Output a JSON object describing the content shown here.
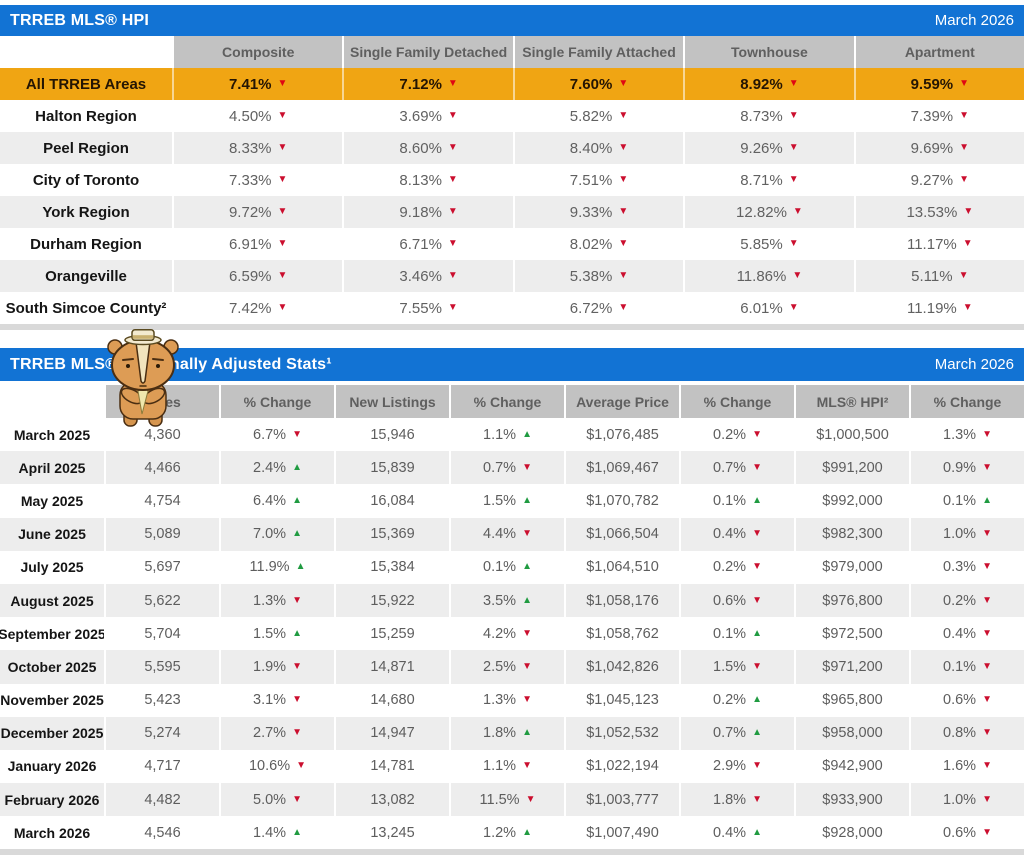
{
  "colors": {
    "header_blue": "#1273d4",
    "highlight_orange": "#f0a513",
    "column_header_gray": "#c2c2c2",
    "alt_row_gray": "#ededed",
    "down_arrow_red": "#cb0e2e",
    "up_arrow_green": "#209b41"
  },
  "hpi_table": {
    "title": "TRREB MLS® HPI",
    "date": "March 2026",
    "columns": [
      "Composite",
      "Single Family Detached",
      "Single Family Attached",
      "Townhouse",
      "Apartment"
    ],
    "highlight_row": {
      "label": "All TRREB Areas",
      "values": [
        {
          "v": "7.41%",
          "d": "down"
        },
        {
          "v": "7.12%",
          "d": "down"
        },
        {
          "v": "7.60%",
          "d": "down"
        },
        {
          "v": "8.92%",
          "d": "down"
        },
        {
          "v": "9.59%",
          "d": "down"
        }
      ]
    },
    "rows": [
      {
        "label": "Halton Region",
        "values": [
          {
            "v": "4.50%",
            "d": "down"
          },
          {
            "v": "3.69%",
            "d": "down"
          },
          {
            "v": "5.82%",
            "d": "down"
          },
          {
            "v": "8.73%",
            "d": "down"
          },
          {
            "v": "7.39%",
            "d": "down"
          }
        ]
      },
      {
        "label": "Peel Region",
        "values": [
          {
            "v": "8.33%",
            "d": "down"
          },
          {
            "v": "8.60%",
            "d": "down"
          },
          {
            "v": "8.40%",
            "d": "down"
          },
          {
            "v": "9.26%",
            "d": "down"
          },
          {
            "v": "9.69%",
            "d": "down"
          }
        ]
      },
      {
        "label": "City of Toronto",
        "values": [
          {
            "v": "7.33%",
            "d": "down"
          },
          {
            "v": "8.13%",
            "d": "down"
          },
          {
            "v": "7.51%",
            "d": "down"
          },
          {
            "v": "8.71%",
            "d": "down"
          },
          {
            "v": "9.27%",
            "d": "down"
          }
        ]
      },
      {
        "label": "York Region",
        "values": [
          {
            "v": "9.72%",
            "d": "down"
          },
          {
            "v": "9.18%",
            "d": "down"
          },
          {
            "v": "9.33%",
            "d": "down"
          },
          {
            "v": "12.82%",
            "d": "down"
          },
          {
            "v": "13.53%",
            "d": "down"
          }
        ]
      },
      {
        "label": "Durham Region",
        "values": [
          {
            "v": "6.91%",
            "d": "down"
          },
          {
            "v": "6.71%",
            "d": "down"
          },
          {
            "v": "8.02%",
            "d": "down"
          },
          {
            "v": "5.85%",
            "d": "down"
          },
          {
            "v": "11.17%",
            "d": "down"
          }
        ]
      },
      {
        "label": "Orangeville",
        "values": [
          {
            "v": "6.59%",
            "d": "down"
          },
          {
            "v": "3.46%",
            "d": "down"
          },
          {
            "v": "5.38%",
            "d": "down"
          },
          {
            "v": "11.86%",
            "d": "down"
          },
          {
            "v": "5.11%",
            "d": "down"
          }
        ]
      },
      {
        "label": "South Simcoe County²",
        "values": [
          {
            "v": "7.42%",
            "d": "down"
          },
          {
            "v": "7.55%",
            "d": "down"
          },
          {
            "v": "6.72%",
            "d": "down"
          },
          {
            "v": "6.01%",
            "d": "down"
          },
          {
            "v": "11.19%",
            "d": "down"
          }
        ]
      }
    ]
  },
  "stats_table": {
    "title": "TRREB MLS® Seasonally Adjusted Stats¹",
    "date": "March 2026",
    "columns": [
      "Sales",
      "% Change",
      "New Listings",
      "% Change",
      "Average Price",
      "% Change",
      "MLS® HPI²",
      "% Change"
    ],
    "rows": [
      {
        "month": "March 2025",
        "cells": [
          "4,360",
          {
            "v": "6.7%",
            "d": "down"
          },
          "15,946",
          {
            "v": "1.1%",
            "d": "up"
          },
          "$1,076,485",
          {
            "v": "0.2%",
            "d": "down"
          },
          "$1,000,500",
          {
            "v": "1.3%",
            "d": "down"
          }
        ]
      },
      {
        "month": "April 2025",
        "cells": [
          "4,466",
          {
            "v": "2.4%",
            "d": "up"
          },
          "15,839",
          {
            "v": "0.7%",
            "d": "down"
          },
          "$1,069,467",
          {
            "v": "0.7%",
            "d": "down"
          },
          "$991,200",
          {
            "v": "0.9%",
            "d": "down"
          }
        ]
      },
      {
        "month": "May 2025",
        "cells": [
          "4,754",
          {
            "v": "6.4%",
            "d": "up"
          },
          "16,084",
          {
            "v": "1.5%",
            "d": "up"
          },
          "$1,070,782",
          {
            "v": "0.1%",
            "d": "up"
          },
          "$992,000",
          {
            "v": "0.1%",
            "d": "up"
          }
        ]
      },
      {
        "month": "June 2025",
        "cells": [
          "5,089",
          {
            "v": "7.0%",
            "d": "up"
          },
          "15,369",
          {
            "v": "4.4%",
            "d": "down"
          },
          "$1,066,504",
          {
            "v": "0.4%",
            "d": "down"
          },
          "$982,300",
          {
            "v": "1.0%",
            "d": "down"
          }
        ]
      },
      {
        "month": "July 2025",
        "cells": [
          "5,697",
          {
            "v": "11.9%",
            "d": "up"
          },
          "15,384",
          {
            "v": "0.1%",
            "d": "up"
          },
          "$1,064,510",
          {
            "v": "0.2%",
            "d": "down"
          },
          "$979,000",
          {
            "v": "0.3%",
            "d": "down"
          }
        ]
      },
      {
        "month": "August 2025",
        "cells": [
          "5,622",
          {
            "v": "1.3%",
            "d": "down"
          },
          "15,922",
          {
            "v": "3.5%",
            "d": "up"
          },
          "$1,058,176",
          {
            "v": "0.6%",
            "d": "down"
          },
          "$976,800",
          {
            "v": "0.2%",
            "d": "down"
          }
        ]
      },
      {
        "month": "September 2025",
        "cells": [
          "5,704",
          {
            "v": "1.5%",
            "d": "up"
          },
          "15,259",
          {
            "v": "4.2%",
            "d": "down"
          },
          "$1,058,762",
          {
            "v": "0.1%",
            "d": "up"
          },
          "$972,500",
          {
            "v": "0.4%",
            "d": "down"
          }
        ]
      },
      {
        "month": "October 2025",
        "cells": [
          "5,595",
          {
            "v": "1.9%",
            "d": "down"
          },
          "14,871",
          {
            "v": "2.5%",
            "d": "down"
          },
          "$1,042,826",
          {
            "v": "1.5%",
            "d": "down"
          },
          "$971,200",
          {
            "v": "0.1%",
            "d": "down"
          }
        ]
      },
      {
        "month": "November 2025",
        "cells": [
          "5,423",
          {
            "v": "3.1%",
            "d": "down"
          },
          "14,680",
          {
            "v": "1.3%",
            "d": "down"
          },
          "$1,045,123",
          {
            "v": "0.2%",
            "d": "up"
          },
          "$965,800",
          {
            "v": "0.6%",
            "d": "down"
          }
        ]
      },
      {
        "month": "December 2025",
        "cells": [
          "5,274",
          {
            "v": "2.7%",
            "d": "down"
          },
          "14,947",
          {
            "v": "1.8%",
            "d": "up"
          },
          "$1,052,532",
          {
            "v": "0.7%",
            "d": "up"
          },
          "$958,000",
          {
            "v": "0.8%",
            "d": "down"
          }
        ]
      },
      {
        "month": "January 2026",
        "cells": [
          "4,717",
          {
            "v": "10.6%",
            "d": "down"
          },
          "14,781",
          {
            "v": "1.1%",
            "d": "down"
          },
          "$1,022,194",
          {
            "v": "2.9%",
            "d": "down"
          },
          "$942,900",
          {
            "v": "1.6%",
            "d": "down"
          }
        ]
      },
      {
        "month": "February 2026",
        "cells": [
          "4,482",
          {
            "v": "5.0%",
            "d": "down"
          },
          "13,082",
          {
            "v": "11.5%",
            "d": "down"
          },
          "$1,003,777",
          {
            "v": "1.8%",
            "d": "down"
          },
          "$933,900",
          {
            "v": "1.0%",
            "d": "down"
          }
        ]
      },
      {
        "month": "March 2026",
        "cells": [
          "4,546",
          {
            "v": "1.4%",
            "d": "up"
          },
          "13,245",
          {
            "v": "1.2%",
            "d": "up"
          },
          "$1,007,490",
          {
            "v": "0.4%",
            "d": "up"
          },
          "$928,000",
          {
            "v": "0.6%",
            "d": "down"
          }
        ]
      }
    ]
  },
  "mascot": {
    "name": "rhino-mascot-with-hat-and-tie"
  }
}
